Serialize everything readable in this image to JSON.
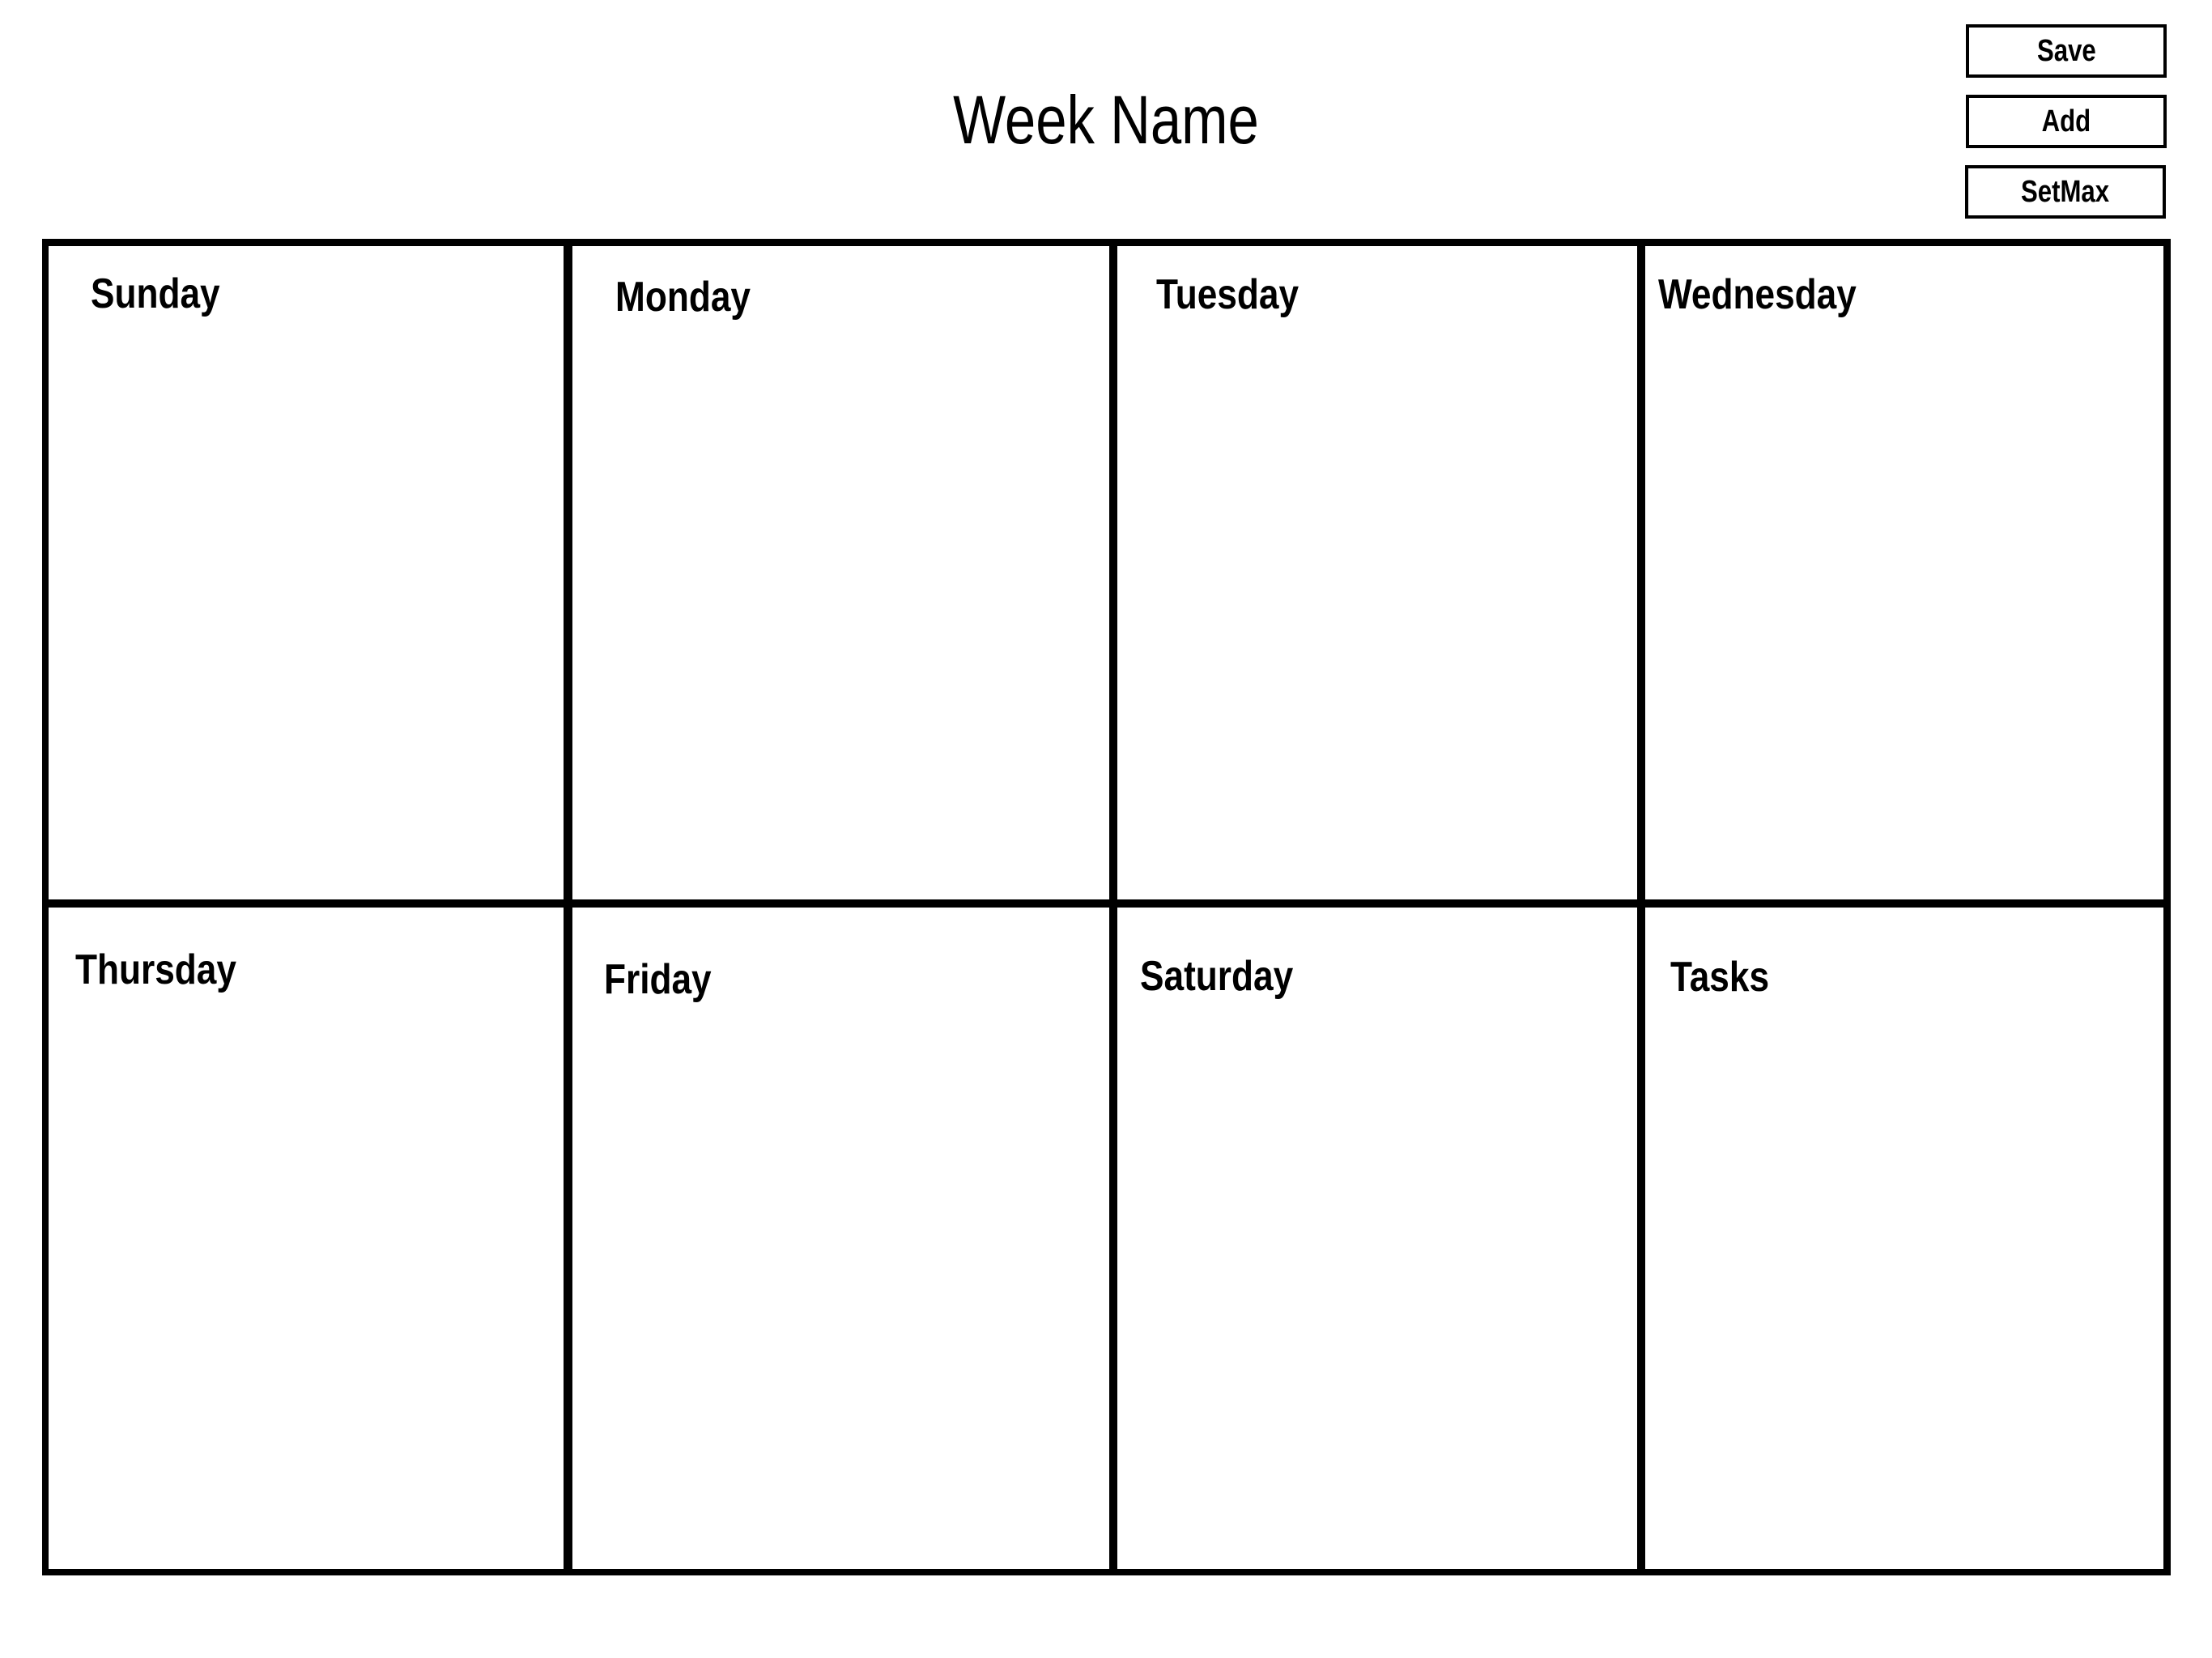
{
  "header": {
    "title": "Week Name"
  },
  "toolbar": {
    "save_label": "Save",
    "add_label": "Add",
    "setmax_label": "SetMax"
  },
  "grid": {
    "cells": [
      {
        "label": "Sunday"
      },
      {
        "label": "Monday"
      },
      {
        "label": "Tuesday"
      },
      {
        "label": "Wednesday"
      },
      {
        "label": "Thursday"
      },
      {
        "label": "Friday"
      },
      {
        "label": "Saturday"
      },
      {
        "label": "Tasks"
      }
    ]
  }
}
